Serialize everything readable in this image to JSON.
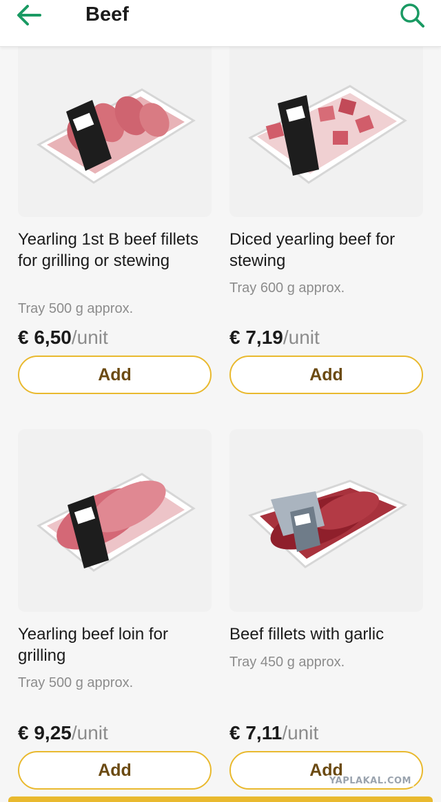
{
  "header": {
    "title": "Beef",
    "back_icon": "arrow-left-icon",
    "search_icon": "search-icon",
    "accent_color": "#1a9a63"
  },
  "products": [
    {
      "name": "Yearling 1st B beef fillets for grilling or stewing",
      "weight": "Tray 500 g approx.",
      "price": "€ 6,50",
      "unit": "/unit",
      "add_label": "Add"
    },
    {
      "name": "Diced yearling beef for stewing",
      "weight": "Tray 600 g approx.",
      "price": "€ 7,19",
      "unit": "/unit",
      "add_label": "Add"
    },
    {
      "name": "Yearling beef loin for grilling",
      "weight": "Tray 500 g approx.",
      "price": "€ 9,25",
      "unit": "/unit",
      "add_label": "Add"
    },
    {
      "name": "Beef fillets with garlic",
      "weight": "Tray 450 g approx.",
      "price": "€ 7,11",
      "unit": "/unit",
      "add_label": "Add"
    }
  ],
  "watermark": "YAPLAKAL.COM",
  "button_border_color": "#e9b92e"
}
